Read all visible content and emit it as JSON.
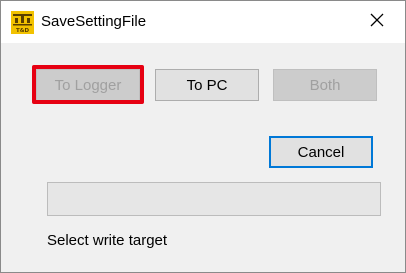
{
  "window": {
    "title": "SaveSettingFile",
    "app_icon": "t-and-d-logo-icon",
    "app_icon_text": "TD",
    "app_icon_subtext": "T&D",
    "close_icon": "close-icon"
  },
  "buttons": {
    "to_logger": {
      "label": "To Logger",
      "enabled": false,
      "highlighted": true
    },
    "to_pc": {
      "label": "To PC",
      "enabled": true
    },
    "both": {
      "label": "Both",
      "enabled": false
    },
    "cancel": {
      "label": "Cancel",
      "enabled": true,
      "focused": true
    }
  },
  "progress": {
    "value": 0
  },
  "status": {
    "text": "Select write target"
  },
  "colors": {
    "highlight_border": "#e60012",
    "focus_border": "#0078d7",
    "icon_yellow": "#f2c200"
  }
}
